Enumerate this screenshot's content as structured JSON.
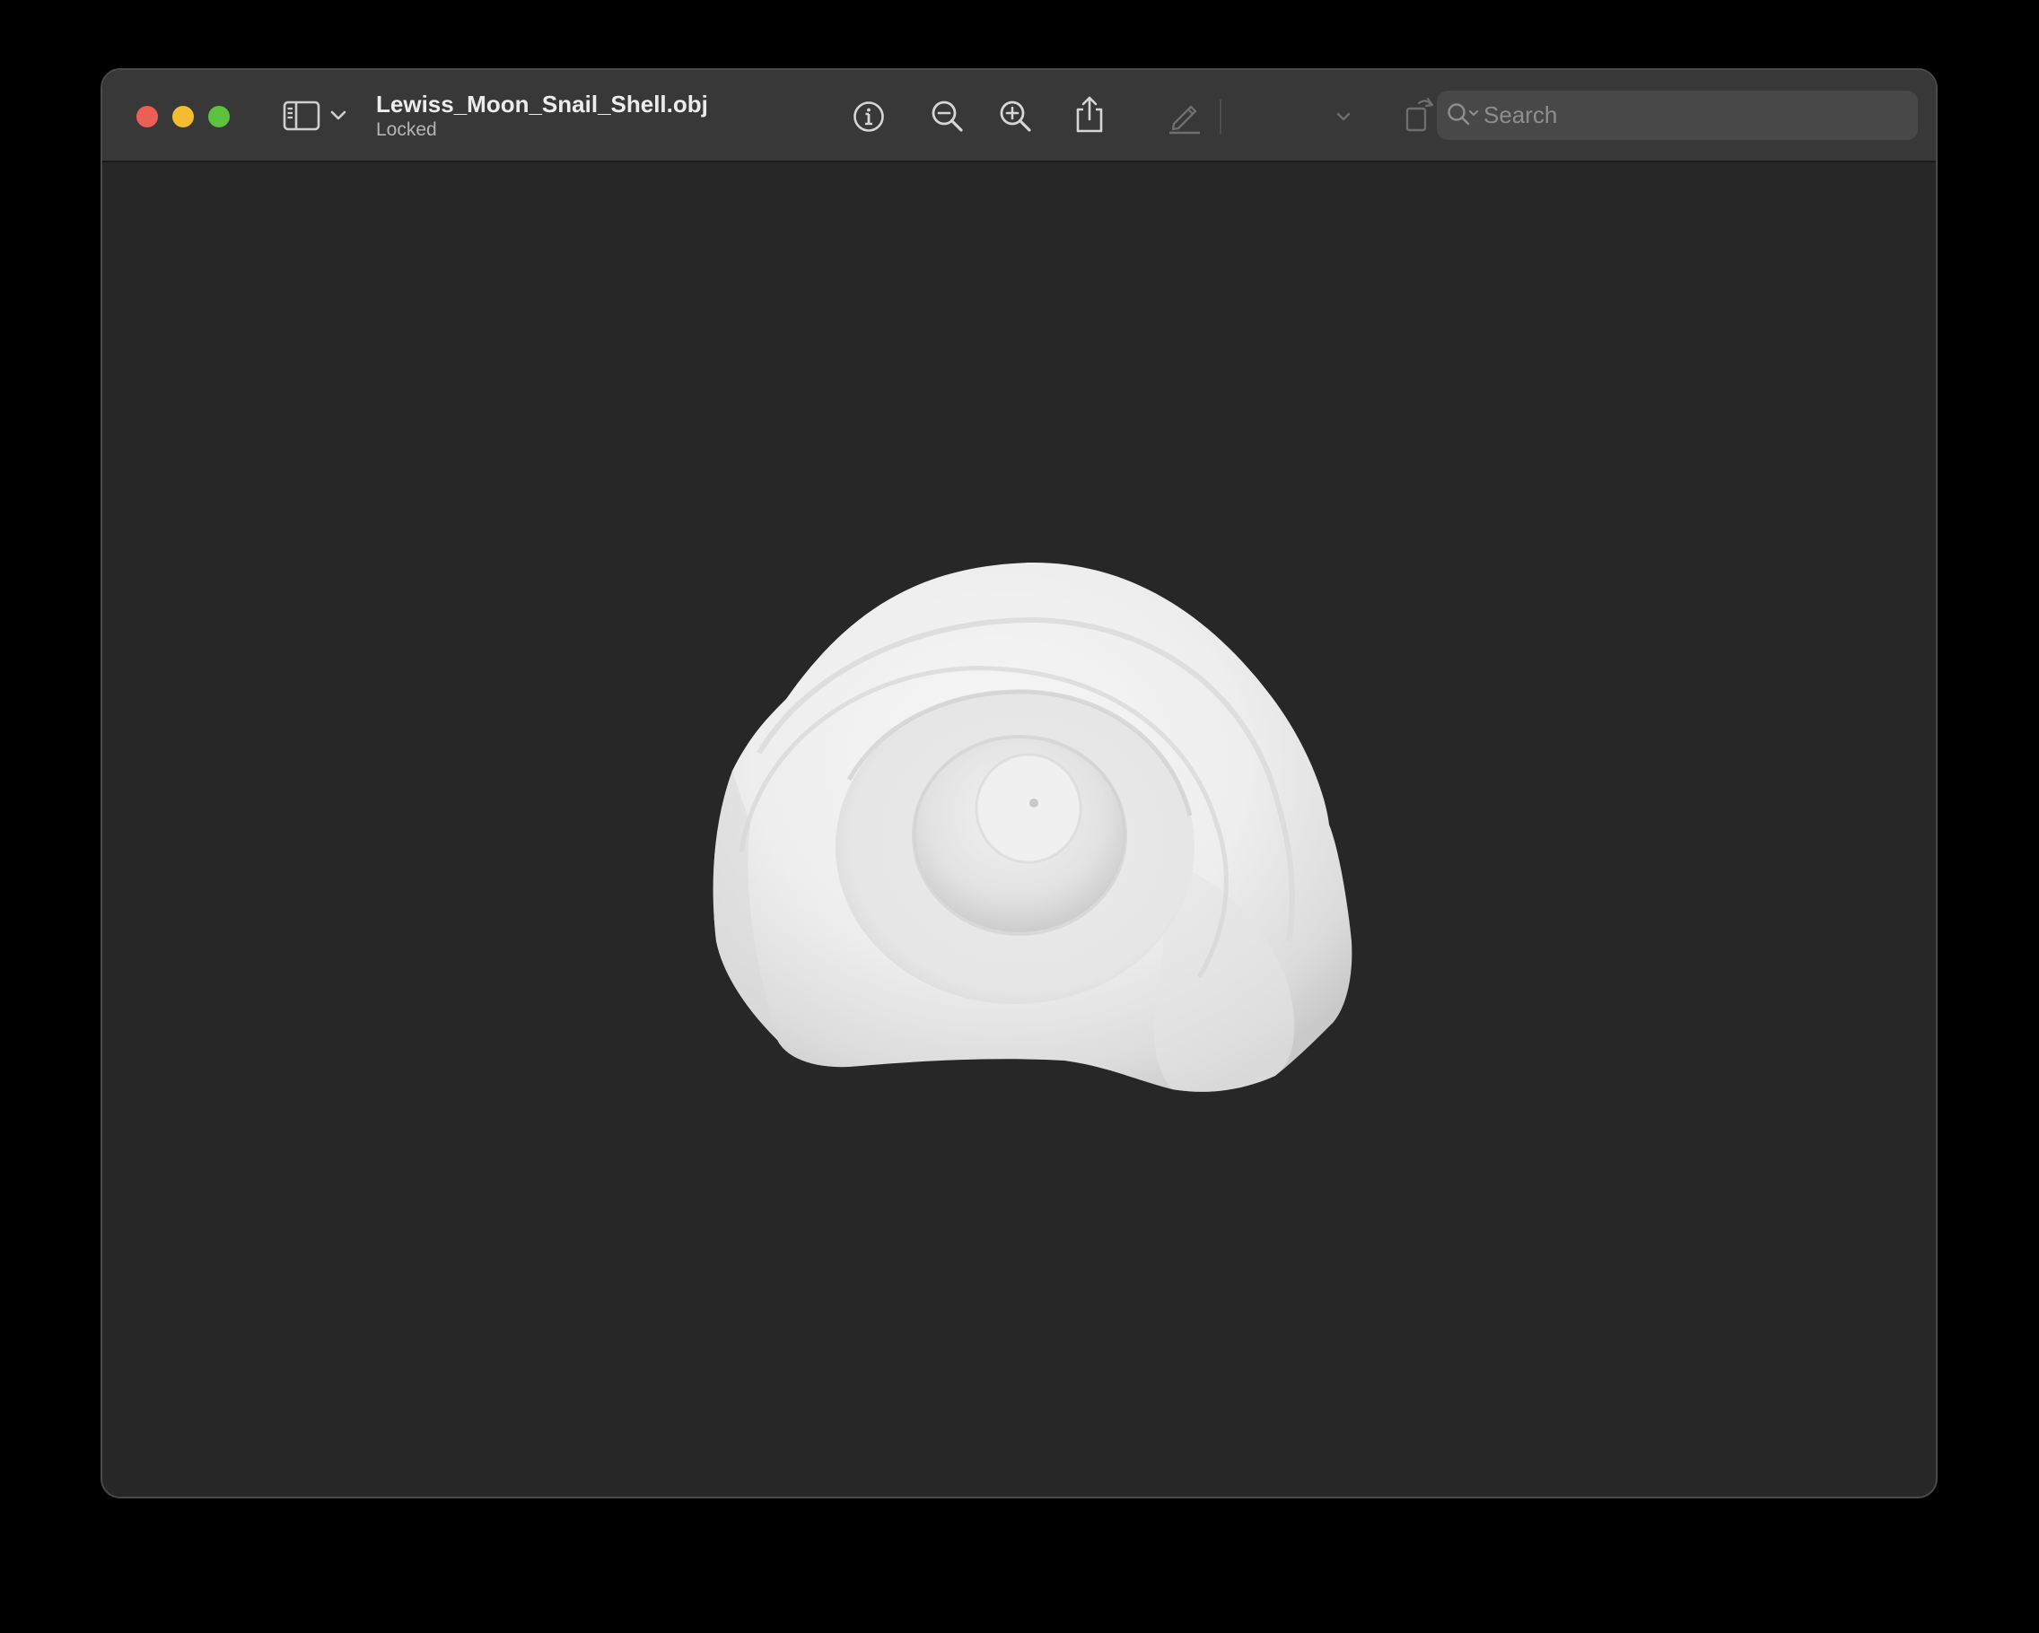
{
  "window": {
    "title": "Lewiss_Moon_Snail_Shell.obj",
    "subtitle": "Locked"
  },
  "toolbar": {
    "traffic_lights": {
      "close_color": "#ec5f57",
      "minimize_color": "#f4bd30",
      "maximize_color": "#5cc23f"
    },
    "icons": [
      "sidebar-toggle-icon",
      "chevron-down-icon",
      "info-icon",
      "zoom-out-icon",
      "zoom-in-icon",
      "share-icon",
      "markup-pen-icon",
      "chevron-down-icon",
      "rotate-icon",
      "annotate-icon"
    ]
  },
  "search": {
    "placeholder": "Search"
  },
  "viewport": {
    "background": "#272727",
    "model": "3d-shell-model"
  }
}
